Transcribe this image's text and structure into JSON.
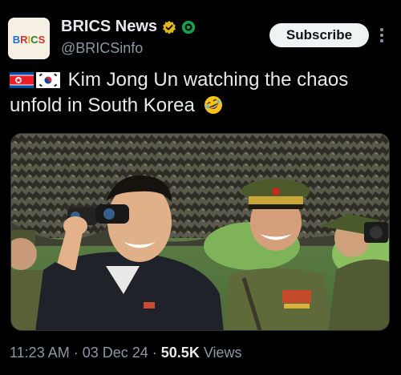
{
  "account": {
    "display_name": "BRICS News",
    "handle": "@BRICSinfo",
    "avatar_text": "BRICS"
  },
  "actions": {
    "subscribe_label": "Subscribe",
    "more_icon": "more-vertical-icon"
  },
  "post": {
    "text_line1": "Kim Jong Un watching the chaos",
    "text_line2": "unfold in South Korea",
    "flags": [
      "north-korea-flag",
      "south-korea-flag"
    ],
    "emoji": "rolling-on-floor-laughing-emoji"
  },
  "meta": {
    "time": "11:23 AM",
    "separator": "·",
    "date": "03 Dec 24",
    "views_count": "50.5K",
    "views_label": "Views"
  },
  "colors": {
    "background": "#000000",
    "text_primary": "#e7e9ea",
    "text_secondary": "#8b98a5",
    "verified_gold": "#e2b719",
    "verified_green": "#16a34a",
    "button_bg": "#eff3f4"
  }
}
